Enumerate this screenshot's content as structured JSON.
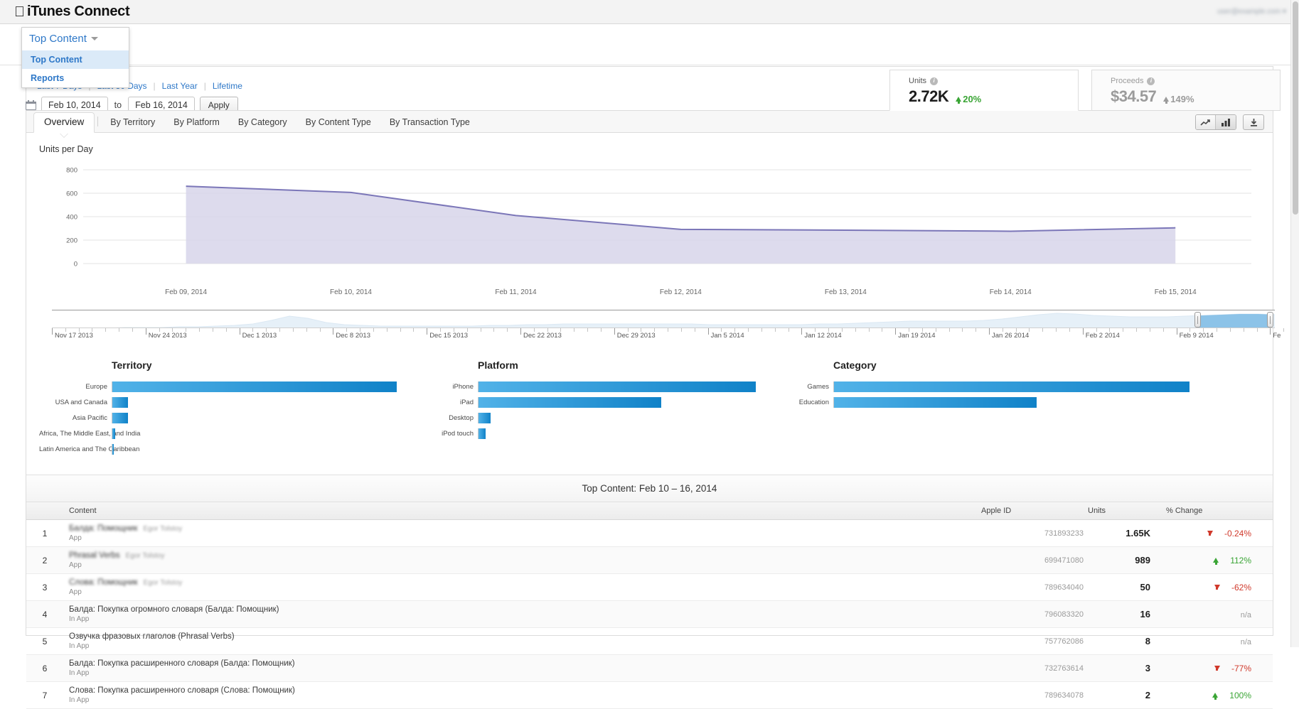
{
  "header": {
    "brand": "iTunes Connect",
    "apple_icon": "apple-logo-icon",
    "account": "user@example.com"
  },
  "module_dropdown": {
    "selected": "Top Content",
    "caret_icon": "chevron-down-icon",
    "items": [
      {
        "label": "Top Content",
        "selected": true
      },
      {
        "label": "Reports",
        "selected": false
      }
    ]
  },
  "quick_ranges": [
    {
      "label": "Last 7 Days"
    },
    {
      "label": "Last 30 Days"
    },
    {
      "label": "Last Year"
    },
    {
      "label": "Lifetime"
    }
  ],
  "date_range": {
    "calendar_icon": "calendar-icon",
    "start": "Feb 10, 2014",
    "to_label": "to",
    "end": "Feb 16, 2014",
    "apply_label": "Apply"
  },
  "kpis": [
    {
      "label": "Units",
      "info_icon": "info-icon",
      "value": "2.72K",
      "delta": "20%",
      "direction": "up",
      "active": true,
      "color": "#3aa535"
    },
    {
      "label": "Proceeds",
      "info_icon": "info-icon",
      "value": "$34.57",
      "delta": "149%",
      "direction": "up",
      "active": false,
      "color": "#9b9b9b"
    }
  ],
  "tabs": [
    {
      "label": "Overview",
      "active": true
    },
    {
      "label": "By Territory",
      "active": false
    },
    {
      "label": "By Platform",
      "active": false
    },
    {
      "label": "By Category",
      "active": false
    },
    {
      "label": "By Content Type",
      "active": false
    },
    {
      "label": "By Transaction Type",
      "active": false
    }
  ],
  "chart_tools": {
    "line_chart_icon": "line-chart-icon",
    "bar_chart_icon": "bar-chart-icon",
    "download_icon": "download-icon"
  },
  "chart_data": {
    "type": "area",
    "title": "Units per Day",
    "xlabel": "",
    "ylabel": "",
    "ylim": [
      0,
      800
    ],
    "yticks": [
      0,
      200,
      400,
      600,
      800
    ],
    "grid": true,
    "legend": "none",
    "accent": "#7b76b8",
    "fill": "#d7d5ea",
    "x": [
      "Feb 09, 2014",
      "Feb 10, 2014",
      "Feb 11, 2014",
      "Feb 12, 2014",
      "Feb 13, 2014",
      "Feb 14, 2014",
      "Feb 15, 2014"
    ],
    "values": [
      660,
      607,
      410,
      292,
      285,
      276,
      305
    ],
    "categories": [
      "Feb 09, 2014",
      "Feb 10, 2014",
      "Feb 11, 2014",
      "Feb 12, 2014",
      "Feb 13, 2014",
      "Feb 14, 2014",
      "Feb 15, 2014"
    ]
  },
  "navigator": {
    "selection_start": "Feb 9 2014",
    "selection_end": "Feb 16 2014",
    "handle_left_icon": "range-handle-left-icon",
    "handle_right_icon": "range-handle-right-icon",
    "ticks": [
      "Nov 17 2013",
      "Nov 24 2013",
      "Dec 1 2013",
      "Dec 8 2013",
      "Dec 15 2013",
      "Dec 22 2013",
      "Dec 29 2013",
      "Jan 5 2014",
      "Jan 12 2014",
      "Jan 19 2014",
      "Jan 26 2014",
      "Feb 2 2014",
      "Feb 9 2014",
      "Fe"
    ]
  },
  "breakdowns": [
    {
      "title": "Territory",
      "type": "bar",
      "orientation": "horizontal",
      "categories": [
        "Europe",
        "USA and Canada",
        "Asia Pacific",
        "Africa, The Middle East, and India",
        "Latin America and The Caribbean"
      ],
      "values": [
        100,
        5.6,
        5.6,
        0.9,
        0.6
      ]
    },
    {
      "title": "Platform",
      "type": "bar",
      "orientation": "horizontal",
      "categories": [
        "iPhone",
        "iPad",
        "Desktop",
        "iPod touch"
      ],
      "values": [
        100,
        66,
        4.3,
        2.6
      ]
    },
    {
      "title": "Category",
      "type": "bar",
      "orientation": "horizontal",
      "categories": [
        "Games",
        "Education"
      ],
      "values": [
        100,
        57
      ]
    }
  ],
  "top_content": {
    "title": "Top Content: Feb 10 – 16, 2014",
    "columns": [
      "",
      "Content",
      "Apple ID",
      "Units",
      "% Change"
    ],
    "rows": [
      {
        "rank": "1",
        "name": "Балда: Помощник",
        "author": "Egor Tolstoy",
        "kind": "App",
        "apple_id": "731893233",
        "units": "1.65K",
        "change": "-0.24%",
        "direction": "down",
        "blurred": true
      },
      {
        "rank": "2",
        "name": "Phrasal Verbs",
        "author": "Egor Tolstoy",
        "kind": "App",
        "apple_id": "699471080",
        "units": "989",
        "change": "112%",
        "direction": "up",
        "blurred": true
      },
      {
        "rank": "3",
        "name": "Слова: Помощник",
        "author": "Egor Tolstoy",
        "kind": "App",
        "apple_id": "789634040",
        "units": "50",
        "change": "-62%",
        "direction": "down",
        "blurred": true
      },
      {
        "rank": "4",
        "name": "Балда: Покупка огромного словаря (Балда: Помощник)",
        "author": "",
        "kind": "In App",
        "apple_id": "796083320",
        "units": "16",
        "change": "n/a",
        "direction": "none",
        "blurred": false
      },
      {
        "rank": "5",
        "name": "Озвучка фразовых глаголов (Phrasal Verbs)",
        "author": "",
        "kind": "In App",
        "apple_id": "757762086",
        "units": "8",
        "change": "n/a",
        "direction": "none",
        "blurred": false
      },
      {
        "rank": "6",
        "name": "Балда: Покупка расширенного словаря (Балда: Помощник)",
        "author": "",
        "kind": "In App",
        "apple_id": "732763614",
        "units": "3",
        "change": "-77%",
        "direction": "down",
        "blurred": false
      },
      {
        "rank": "7",
        "name": "Слова: Покупка расширенного словаря (Слова: Помощник)",
        "author": "",
        "kind": "In App",
        "apple_id": "789634078",
        "units": "2",
        "change": "100%",
        "direction": "up",
        "blurred": false
      }
    ]
  }
}
